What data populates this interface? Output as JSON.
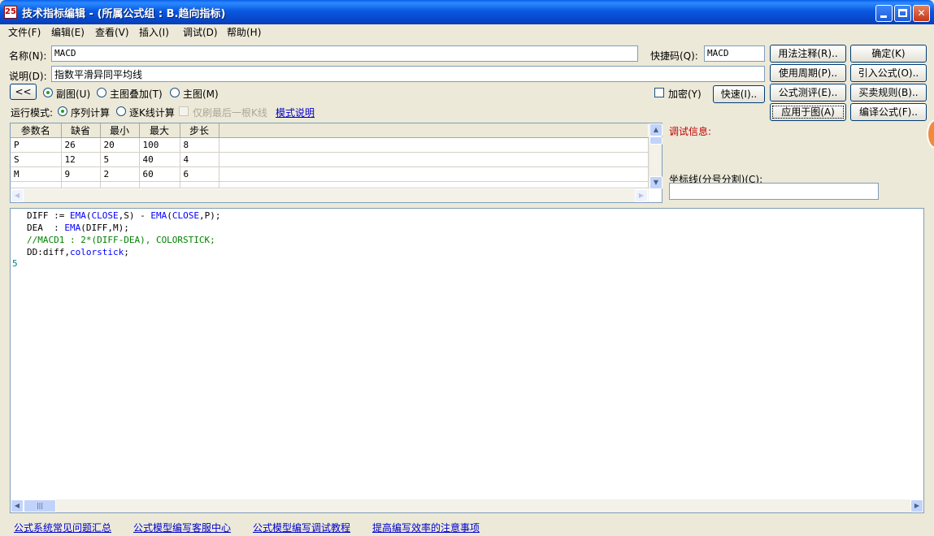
{
  "window": {
    "title": "技术指标编辑 - (所属公式组 : B.趋向指标)",
    "icon_text": "25"
  },
  "menu": [
    "文件(F)",
    "编辑(E)",
    "查看(V)",
    "插入(I)",
    "调试(D)",
    "帮助(H)"
  ],
  "form": {
    "name_label": "名称(N):",
    "name_value": "MACD",
    "hotkey_label": "快捷码(Q):",
    "hotkey_value": "MACD",
    "desc_label": "说明(D):",
    "desc_value": "指数平滑异同平均线",
    "collapse_button": "<<",
    "chart_radios": [
      {
        "label": "副图(U)",
        "selected": true
      },
      {
        "label": "主图叠加(T)",
        "selected": false
      },
      {
        "label": "主图(M)",
        "selected": false
      }
    ],
    "encrypt_label": "加密(Y)",
    "quick_button": "快速(I)..",
    "run_mode_label": "运行模式:",
    "run_radios": [
      {
        "label": "序列计算",
        "selected": true
      },
      {
        "label": "逐K线计算",
        "selected": false
      }
    ],
    "last_bar_label": "仅刷最后一根K线",
    "mode_link": "模式说明"
  },
  "right_buttons": {
    "usage_notes": "用法注释(R)..",
    "ok": "确定(K)",
    "period": "使用周期(P)..",
    "import_formula": "引入公式(O)..",
    "evaluate": "公式测评(E)..",
    "trade_rules": "买卖规则(B)..",
    "apply_chart": "应用于图(A)",
    "compile": "编译公式(F).."
  },
  "params": {
    "headers": [
      "参数名",
      "缺省",
      "最小",
      "最大",
      "步长"
    ],
    "rows": [
      [
        "P",
        "26",
        "20",
        "100",
        "8"
      ],
      [
        "S",
        "12",
        "5",
        "40",
        "4"
      ],
      [
        "M",
        "9",
        "2",
        "60",
        "6"
      ]
    ]
  },
  "debug": {
    "label": "调试信息:",
    "coord_label": "坐标线(分号分割)(C):",
    "coord_value": ""
  },
  "code": {
    "line1_a": "DIFF := ",
    "line1_b": "EMA",
    "line1_c": "(",
    "line1_d": "CLOSE",
    "line1_e": ",S) - ",
    "line1_f": "EMA",
    "line1_g": "(",
    "line1_h": "CLOSE",
    "line1_i": ",P);",
    "line2_a": "DEA  : ",
    "line2_b": "EMA",
    "line2_c": "(DIFF,M);",
    "line3": "//MACD1 : 2*(DIFF-DEA), COLORSTICK;",
    "line4_a": "DD:diff,",
    "line4_b": "colorstick",
    "line4_c": ";",
    "current_line_number": "5"
  },
  "footer_links": [
    "公式系统常见问题汇总",
    "公式模型编写客服中心",
    "公式模型编写调试教程",
    "提高编写效率的注意事项"
  ]
}
